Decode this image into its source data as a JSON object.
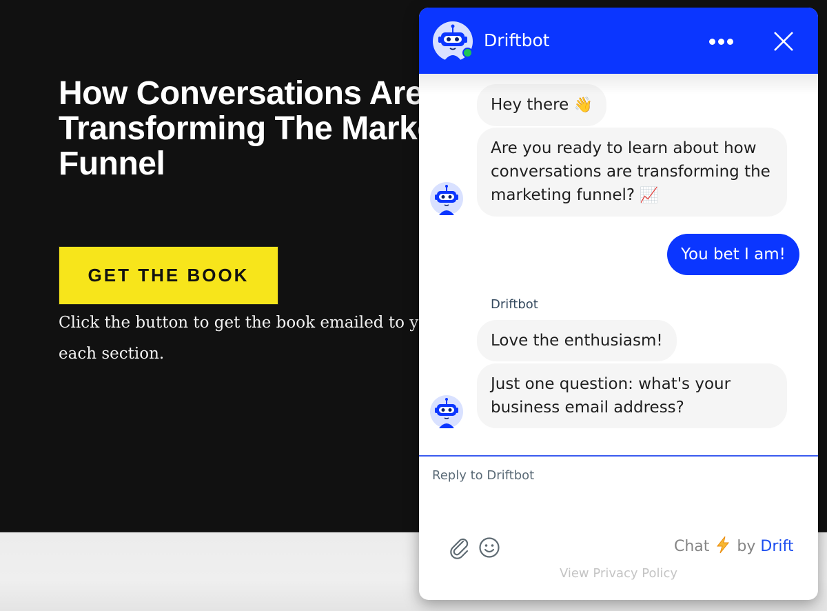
{
  "page": {
    "hero_title": "How Conversations Are Transforming The Marketing Funnel",
    "cta_label": "GET THE BOOK",
    "description": "Click the button to get the book emailed to you, and read each section."
  },
  "chat": {
    "header": {
      "title": "Driftbot",
      "status": "online",
      "more_icon": "more-horizontal-icon",
      "close_icon": "close-icon"
    },
    "messages": [
      {
        "sender": "bot",
        "text": "Hey there",
        "emoji": "👋"
      },
      {
        "sender": "bot",
        "text": "Are you ready to learn about how conversations are transforming the marketing funnel?",
        "emoji": "📈"
      },
      {
        "sender": "user",
        "text": "You bet I am!"
      },
      {
        "sender": "bot",
        "sender_label": "Driftbot",
        "text": "Love the enthusiasm!"
      },
      {
        "sender": "bot",
        "text": "Just one question: what's your business email address?"
      }
    ],
    "composer": {
      "placeholder": "Reply to Driftbot",
      "value": "",
      "attach_icon": "paperclip-icon",
      "emoji_icon": "smiley-icon"
    },
    "branding": {
      "prefix": "Chat",
      "by": "by",
      "brand": "Drift"
    },
    "privacy_link": "View Privacy Policy",
    "colors": {
      "brand_blue": "#0b36ff",
      "online_green": "#1fc556",
      "cta_yellow": "#f7e51b",
      "bubble_gray": "#f5f5f5"
    }
  }
}
